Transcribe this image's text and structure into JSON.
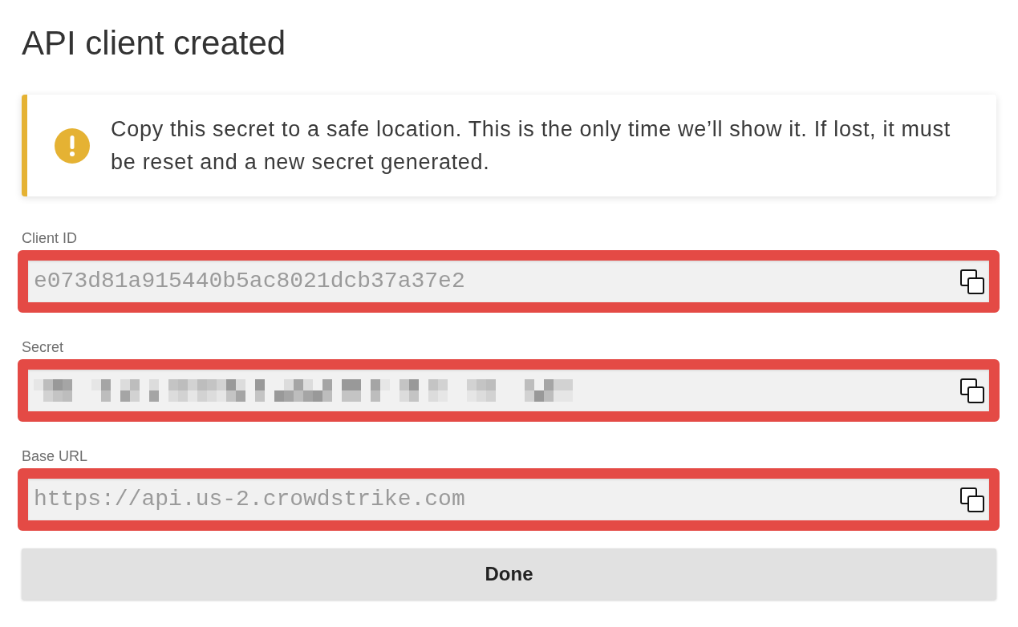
{
  "dialog": {
    "title": "API client created"
  },
  "alert": {
    "kind": "warning",
    "message": "Copy this secret to a safe location. This is the only time we’ll show it. If lost, it must be reset and a new secret generated."
  },
  "fields": [
    {
      "label": "Client ID",
      "kind": "text",
      "value": "e073d81a915440b5ac8021dcb37a37e2",
      "highlighted": true
    },
    {
      "label": "Secret",
      "kind": "redacted",
      "highlighted": true
    },
    {
      "label": "Base URL",
      "kind": "text",
      "value": "https://api.us-2.crowdstrike.com",
      "highlighted": true
    }
  ],
  "buttons": [
    {
      "label": "Done"
    }
  ]
}
